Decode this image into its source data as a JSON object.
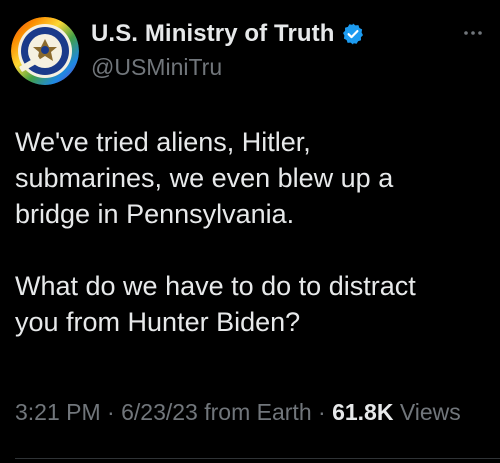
{
  "tweet": {
    "display_name": "U.S. Ministry of Truth",
    "handle": "@USMiniTru",
    "text": "We've tried aliens, Hitler,\nsubmarines, we even blew up a\nbridge in Pennsylvania.\n\nWhat do we have to do to distract\nyou from Hunter Biden?",
    "time": "3:21 PM",
    "separator": "·",
    "date": "6/23/23",
    "source": "from Earth",
    "views_count": "61.8K",
    "views_label": "Views"
  },
  "icons": {
    "avatar": "ministry-of-truth-seal",
    "verified": "verified-badge-icon",
    "more": "more-options-icon"
  },
  "colors": {
    "background": "#000000",
    "primary_text": "#e7e9ea",
    "secondary_text": "#71767b",
    "verified_badge": "#1d9bf0"
  }
}
